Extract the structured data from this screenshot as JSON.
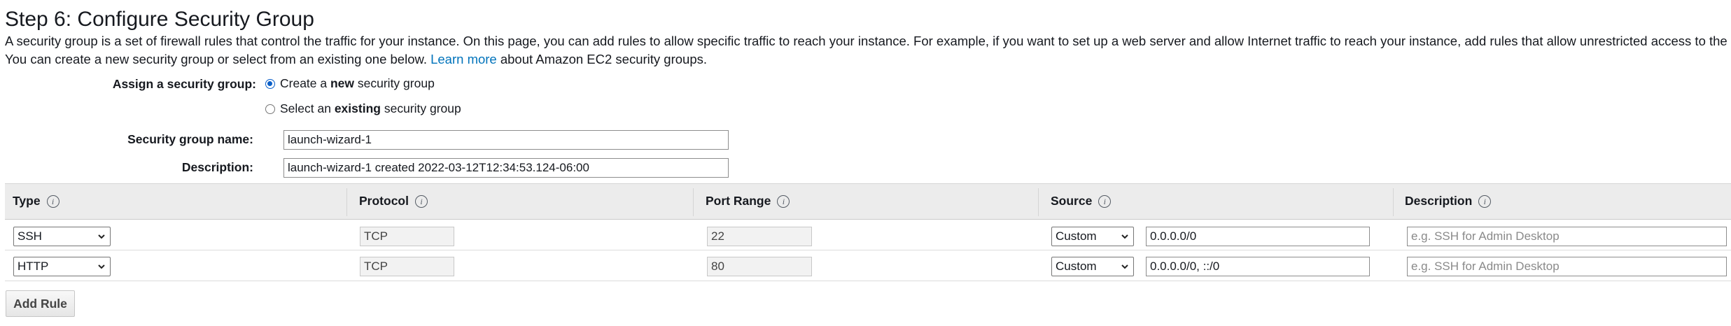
{
  "page": {
    "title": "Step 6: Configure Security Group",
    "intro_line1": "A security group is a set of firewall rules that control the traffic for your instance. On this page, you can add rules to allow specific traffic to reach your instance. For example, if you want to set up a web server and allow Internet traffic to reach your instance, add rules that allow unrestricted access to the HTTP and HTTPS ports.",
    "intro_line2_prefix": "You can create a new security group or select from an existing one below.",
    "learn_more": "Learn more",
    "intro_line2_suffix": "about Amazon EC2 security groups."
  },
  "assign": {
    "label": "Assign a security group:",
    "option_new": {
      "before": "Create a ",
      "bold": "new",
      "after": " security group",
      "selected": true
    },
    "option_existing": {
      "before": "Select an ",
      "bold": "existing",
      "after": " security group",
      "selected": false
    }
  },
  "group_name": {
    "label": "Security group name:",
    "value": "launch-wizard-1"
  },
  "description": {
    "label": "Description:",
    "value": "launch-wizard-1 created 2022-03-12T12:34:53.124-06:00"
  },
  "table": {
    "headers": [
      "Type",
      "Protocol",
      "Port Range",
      "Source",
      "Description"
    ],
    "rows": [
      {
        "type": "SSH",
        "protocol": "TCP",
        "port": "22",
        "source_mode": "Custom",
        "source_value": "0.0.0.0/0",
        "desc_placeholder": "e.g. SSH for Admin Desktop"
      },
      {
        "type": "HTTP",
        "protocol": "TCP",
        "port": "80",
        "source_mode": "Custom",
        "source_value": "0.0.0.0/0, ::/0",
        "desc_placeholder": "e.g. SSH for Admin Desktop"
      }
    ]
  },
  "add_rule_button": "Add Rule",
  "icons": {
    "info": "info-icon",
    "dropdown": "chevron-down-icon"
  },
  "colors": {
    "link": "#0073bb",
    "header_bg": "#ececec",
    "radio_selected": "#0a5fc8"
  }
}
